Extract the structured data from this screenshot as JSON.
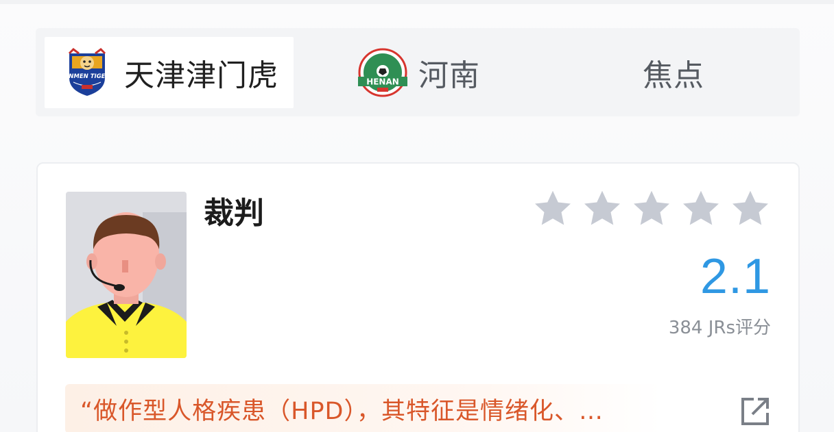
{
  "tabs": {
    "home": {
      "label": "天津津门虎",
      "logo_text": "JINMEN TIGER"
    },
    "away": {
      "label": "河南",
      "logo_text": "HENAN"
    },
    "focus": {
      "label": "焦点"
    }
  },
  "referee": {
    "title": "裁判",
    "stars_total": 5,
    "stars_filled": 0,
    "score": "2.1",
    "rating_count": "384 JRs评分",
    "quote": "“做作型人格疾患（HPD），其特征是情绪化、…"
  },
  "colors": {
    "accent_blue": "#2f98e3",
    "quote_orange": "#d9572a",
    "star_empty": "#c6cad3",
    "referee_shirt": "#fdf23e"
  },
  "icons": {
    "share": "share-external-icon",
    "star": "star-icon"
  }
}
